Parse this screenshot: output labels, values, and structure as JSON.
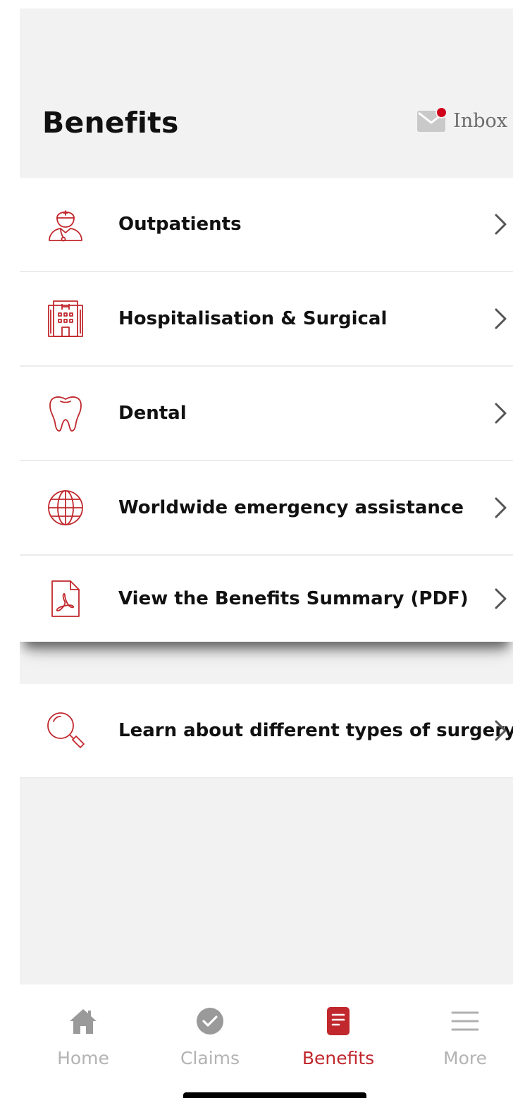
{
  "header": {
    "title": "Benefits",
    "inbox_label": "Inbox"
  },
  "menu": {
    "items": [
      {
        "label": "Outpatients",
        "icon": "doctor-icon"
      },
      {
        "label": "Hospitalisation & Surgical",
        "icon": "hospital-icon"
      },
      {
        "label": "Dental",
        "icon": "tooth-icon"
      },
      {
        "label": "Worldwide emergency assistance",
        "icon": "globe-icon"
      },
      {
        "label": "View the Benefits Summary (PDF)",
        "icon": "pdf-file-icon"
      }
    ]
  },
  "extra": {
    "label": "Learn about different types of surgery",
    "icon": "magnifier-icon"
  },
  "tabbar": {
    "tabs": [
      {
        "label": "Home",
        "icon": "home-icon"
      },
      {
        "label": "Claims",
        "icon": "check-circle-icon"
      },
      {
        "label": "Benefits",
        "icon": "benefits-icon",
        "active": true
      },
      {
        "label": "More",
        "icon": "hamburger-menu-icon"
      }
    ]
  },
  "colors": {
    "accent": "#c0282d",
    "background": "#f2f2f2",
    "tab_inactive": "#b3b3b3",
    "notification_dot": "#d0021b"
  }
}
